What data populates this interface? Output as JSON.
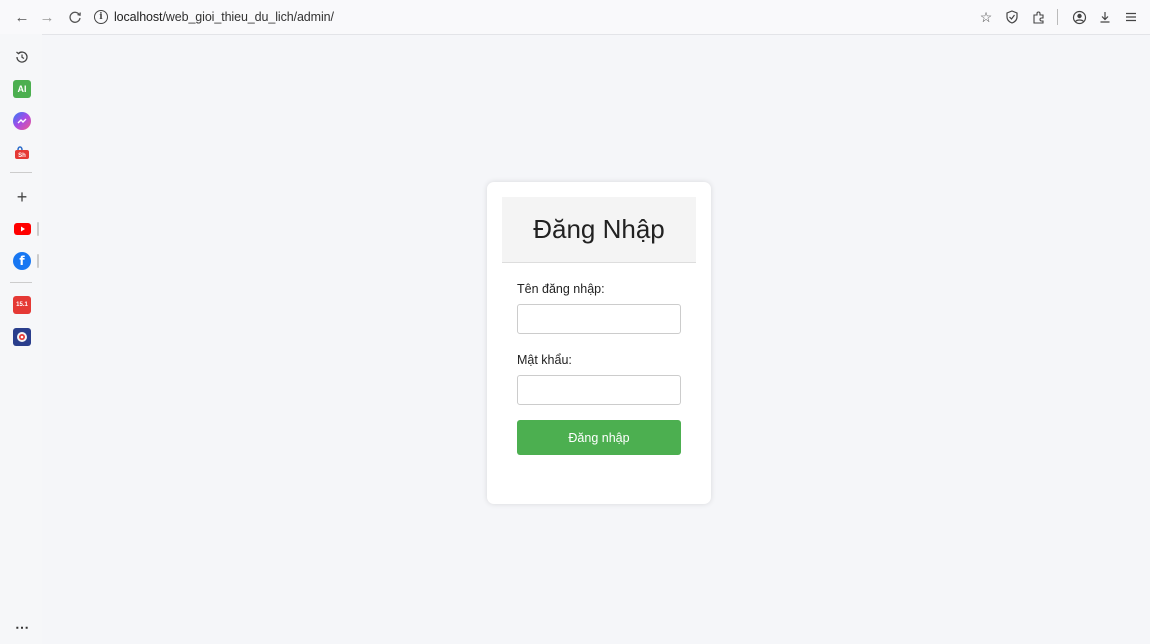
{
  "browser": {
    "url_host": "localhost",
    "url_path": "/web_gioi_thieu_du_lich/admin/",
    "nav": {
      "back_icon": "arrow-left-icon",
      "forward_icon": "arrow-right-icon",
      "reload_icon": "reload-icon",
      "site_info_icon": "info-icon"
    },
    "right_icons": [
      "star-icon",
      "shield-icon",
      "extensions-icon",
      "account-icon",
      "download-icon",
      "menu-icon"
    ]
  },
  "sidebar": {
    "items": [
      {
        "name": "history-icon",
        "color": "#444444"
      },
      {
        "name": "ai-chat-icon",
        "color": "#4caf50",
        "glyph": "AI"
      },
      {
        "name": "messenger-icon",
        "color": "#7b5cf0"
      },
      {
        "name": "shopee-icon",
        "color": "#e53935"
      },
      {
        "name": "add-icon",
        "color": "#444444"
      },
      {
        "name": "youtube-icon",
        "color": "#ff0000"
      },
      {
        "name": "facebook-icon",
        "color": "#1877f2"
      },
      {
        "name": "calendar-15-1-icon",
        "color": "#e53935",
        "glyph": "15.1"
      },
      {
        "name": "app-icon",
        "color": "#2a3e8c"
      }
    ],
    "more_icon": "more-icon"
  },
  "login": {
    "title": "Đăng Nhập",
    "username_label": "Tên đăng nhập:",
    "username_value": "",
    "password_label": "Mật khẩu:",
    "password_value": "",
    "submit_label": "Đăng nhập",
    "accent_color": "#4caf50"
  }
}
